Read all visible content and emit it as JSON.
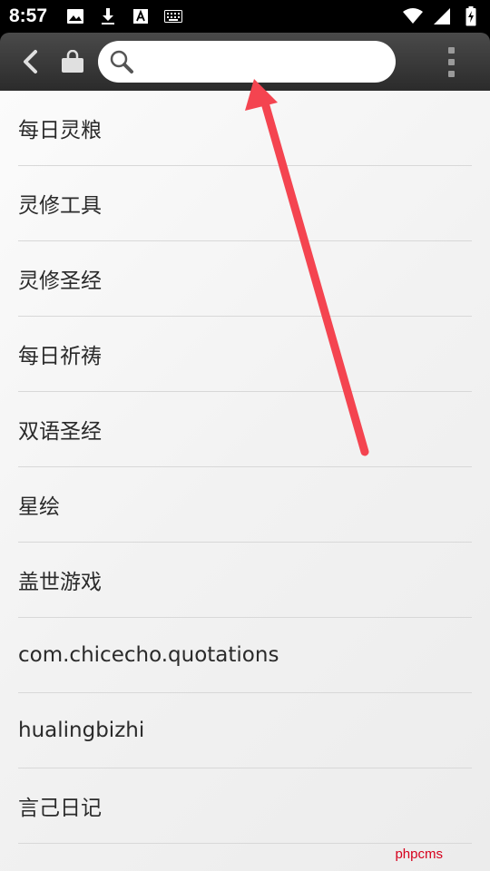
{
  "status_bar": {
    "time": "8:57",
    "icons_left": [
      "image-icon",
      "download-icon",
      "font-a-icon",
      "keyboard-icon"
    ],
    "icons_right": [
      "wifi-icon",
      "signal-icon",
      "battery-charging-icon"
    ]
  },
  "toolbar": {
    "back_icon": "chevron-left-icon",
    "store_icon": "shopping-bag-icon",
    "search": {
      "value": "",
      "placeholder": "",
      "icon": "search-icon"
    },
    "menu_icon": "overflow-menu-icon"
  },
  "list": {
    "items": [
      {
        "label": "每日灵粮"
      },
      {
        "label": "灵修工具"
      },
      {
        "label": "灵修圣经"
      },
      {
        "label": "每日祈祷"
      },
      {
        "label": "双语圣经"
      },
      {
        "label": "星绘"
      },
      {
        "label": "盖世游戏"
      },
      {
        "label": "com.chicecho.quotations"
      },
      {
        "label": "hualingbizhi"
      },
      {
        "label": "言己日记"
      }
    ]
  },
  "watermark": "phpcms",
  "colors": {
    "toolbar": "#3a3a3a",
    "arrow": "#f44450",
    "watermark": "#d6001c"
  }
}
